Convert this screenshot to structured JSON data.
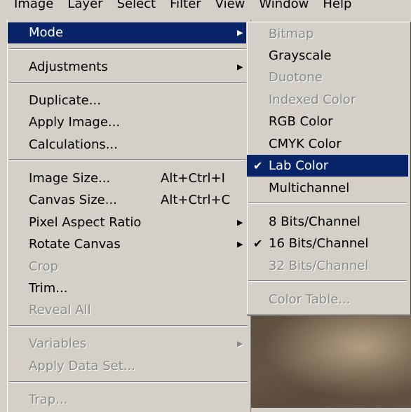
{
  "menubar": {
    "items": [
      "Image",
      "Layer",
      "Select",
      "Filter",
      "View",
      "Window",
      "Help"
    ]
  },
  "image_menu": {
    "mode": "Mode",
    "adjustments": "Adjustments",
    "duplicate": "Duplicate...",
    "apply_image": "Apply Image...",
    "calculations": "Calculations...",
    "image_size": "Image Size...",
    "image_size_shortcut": "Alt+Ctrl+I",
    "canvas_size": "Canvas Size...",
    "canvas_size_shortcut": "Alt+Ctrl+C",
    "pixel_aspect_ratio": "Pixel Aspect Ratio",
    "rotate_canvas": "Rotate Canvas",
    "crop": "Crop",
    "trim": "Trim...",
    "reveal_all": "Reveal All",
    "variables": "Variables",
    "apply_data_set": "Apply Data Set...",
    "trap": "Trap..."
  },
  "mode_submenu": {
    "bitmap": "Bitmap",
    "grayscale": "Grayscale",
    "duotone": "Duotone",
    "indexed_color": "Indexed Color",
    "rgb_color": "RGB Color",
    "cmyk_color": "CMYK Color",
    "lab_color": "Lab Color",
    "multichannel": "Multichannel",
    "bits_8": "8 Bits/Channel",
    "bits_16": "16 Bits/Channel",
    "bits_32": "32 Bits/Channel",
    "color_table": "Color Table...",
    "checked_mode": "Lab Color",
    "checked_depth": "16 Bits/Channel"
  },
  "glyphs": {
    "arrow": "▶",
    "check": "✔"
  },
  "colors": {
    "menu_bg": "#d4d0c8",
    "highlight": "#0a246a",
    "disabled": "#8a8a8a"
  }
}
